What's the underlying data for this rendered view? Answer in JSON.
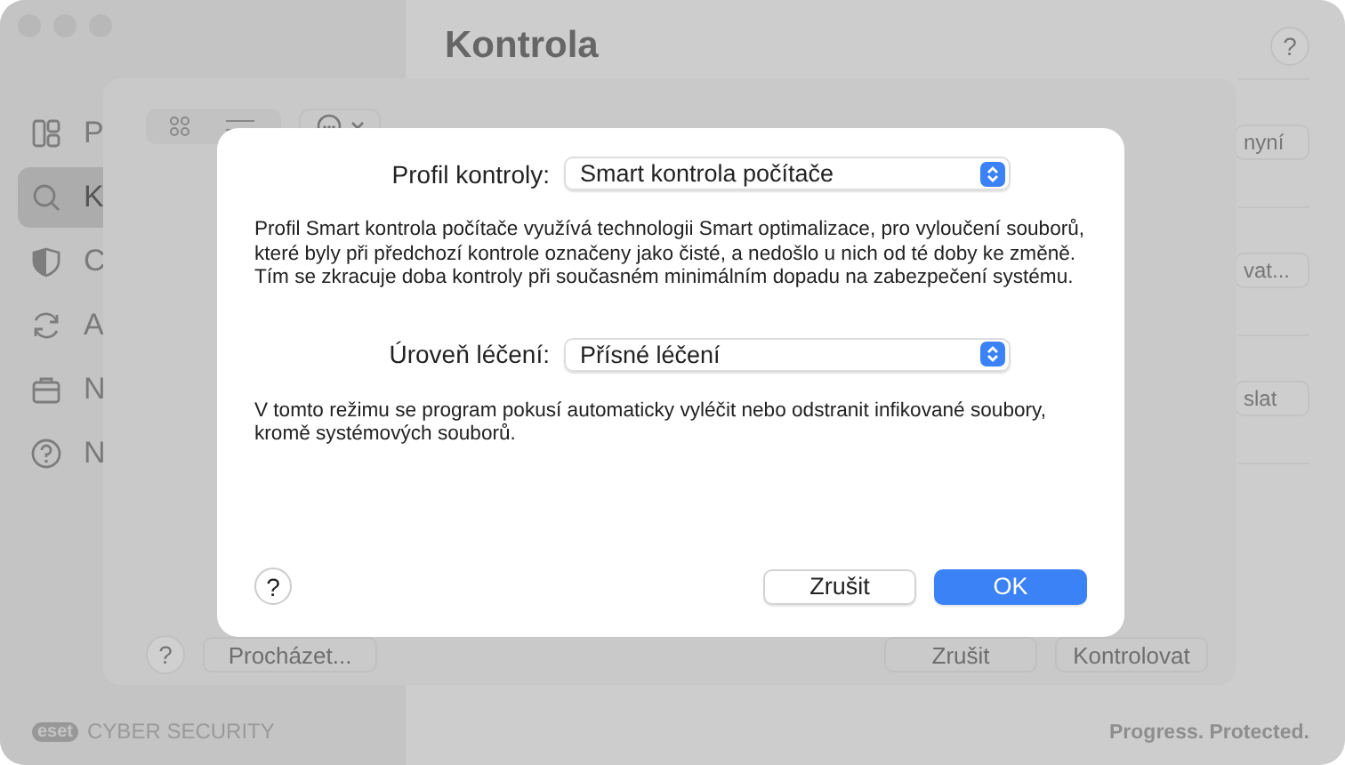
{
  "window": {
    "title": "Kontrola",
    "help": "?"
  },
  "sidebar": {
    "items": [
      {
        "label": "P",
        "selected": false
      },
      {
        "label": "K",
        "selected": true
      },
      {
        "label": "C",
        "selected": false
      },
      {
        "label": "A",
        "selected": false
      },
      {
        "label": "N",
        "selected": false
      },
      {
        "label": "N",
        "selected": false
      }
    ]
  },
  "side_buttons": [
    "nyní",
    "vat...",
    "slat"
  ],
  "brand": {
    "logo": "eset",
    "name": "CYBER SECURITY",
    "tagline": "Progress. Protected."
  },
  "scan_sheet": {
    "footer_left": [
      {
        "label": "?",
        "kind": "help"
      },
      {
        "label": "Procházet...",
        "kind": "button"
      }
    ],
    "footer_right": [
      "Zrušit",
      "Kontrolovat"
    ]
  },
  "dialog": {
    "fields": [
      {
        "label": "Profil kontroly:",
        "value": "Smart kontrola počítače",
        "description": "Profil Smart kontrola počítače využívá technologii Smart optimalizace, pro vyloučení souborů, které byly při předchozí kontrole označeny jako čisté, a nedošlo u nich od té doby ke změně. Tím se zkracuje doba kontroly při současném minimálním dopadu na zabezpečení systému."
      },
      {
        "label": "Úroveň léčení:",
        "value": "Přísné léčení",
        "description": "V tomto režimu se program pokusí automaticky vyléčit nebo odstranit infikované soubory, kromě systémových souborů."
      }
    ],
    "help": "?",
    "buttons": [
      {
        "label": "Zrušit",
        "primary": false
      },
      {
        "label": "OK",
        "primary": true
      }
    ]
  }
}
